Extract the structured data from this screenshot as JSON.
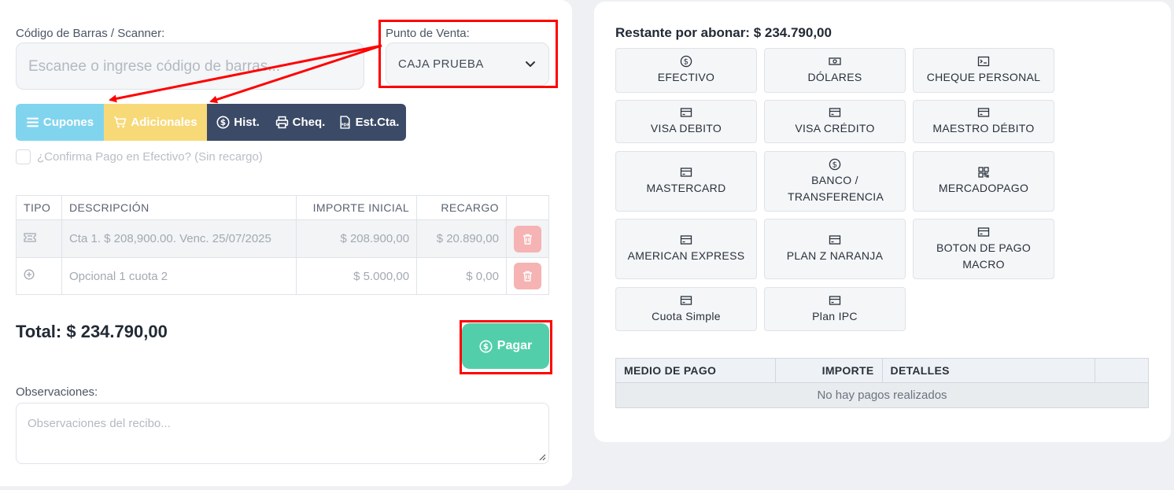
{
  "left": {
    "barcode_label": "Código de Barras / Scanner:",
    "barcode_placeholder": "Escanee o ingrese código de barras...",
    "pv_label": "Punto de Venta:",
    "pv_value": "CAJA PRUEBA",
    "buttons": {
      "cupones": "Cupones",
      "adicionales": "Adicionales",
      "hist": "Hist.",
      "cheq": "Cheq.",
      "estcta": "Est.Cta."
    },
    "confirm_label": "¿Confirma Pago en Efectivo? (Sin recargo)",
    "table": {
      "headers": [
        "TIPO",
        "DESCRIPCIÓN",
        "IMPORTE INICIAL",
        "RECARGO",
        ""
      ],
      "rows": [
        {
          "tipo_icon": "ticket-icon",
          "descripcion": "Cta 1. $ 208,900.00. Venc. 25/07/2025",
          "importe": "$ 208.900,00",
          "recargo": "$ 20.890,00"
        },
        {
          "tipo_icon": "plus-circle-icon",
          "descripcion": "Opcional 1 cuota 2",
          "importe": "$ 5.000,00",
          "recargo": "$ 0,00"
        }
      ]
    },
    "total": "Total: $ 234.790,00",
    "pagar": "Pagar",
    "obs_label": "Observaciones:",
    "obs_placeholder": "Observaciones del recibo..."
  },
  "right": {
    "restante": "Restante por abonar: $ 234.790,00",
    "methods": [
      {
        "label": "EFECTIVO",
        "icon": "dollar-circle-icon"
      },
      {
        "label": "DÓLARES",
        "icon": "cash-icon"
      },
      {
        "label": "CHEQUE PERSONAL",
        "icon": "terminal-icon"
      },
      {
        "label": "VISA DEBITO",
        "icon": "credit-card-icon"
      },
      {
        "label": "VISA CRÉDITO",
        "icon": "credit-card-icon"
      },
      {
        "label": "MAESTRO DÉBITO",
        "icon": "credit-card-icon"
      },
      {
        "label": "MASTERCARD",
        "icon": "credit-card-icon"
      },
      {
        "label": "BANCO / TRANSFERENCIA",
        "icon": "dollar-circle-icon"
      },
      {
        "label": "MERCADOPAGO",
        "icon": "qr-code-icon"
      },
      {
        "label": "AMERICAN EXPRESS",
        "icon": "credit-card-icon"
      },
      {
        "label": "PLAN Z NARANJA",
        "icon": "credit-card-icon"
      },
      {
        "label": "BOTON DE PAGO MACRO",
        "icon": "credit-card-icon"
      },
      {
        "label": "Cuota Simple",
        "icon": "credit-card-icon"
      },
      {
        "label": "Plan IPC",
        "icon": "credit-card-icon"
      }
    ],
    "pagos_headers": [
      "MEDIO DE PAGO",
      "IMPORTE",
      "DETALLES",
      ""
    ],
    "pagos_empty": "No hay pagos realizados"
  },
  "colors": {
    "cupones": "#81d4ee",
    "adicionales": "#f7d978",
    "dark": "#3b4a66",
    "pagar": "#52cfaa",
    "trash": "#f6b3b3",
    "annotation": "#ff0000"
  }
}
